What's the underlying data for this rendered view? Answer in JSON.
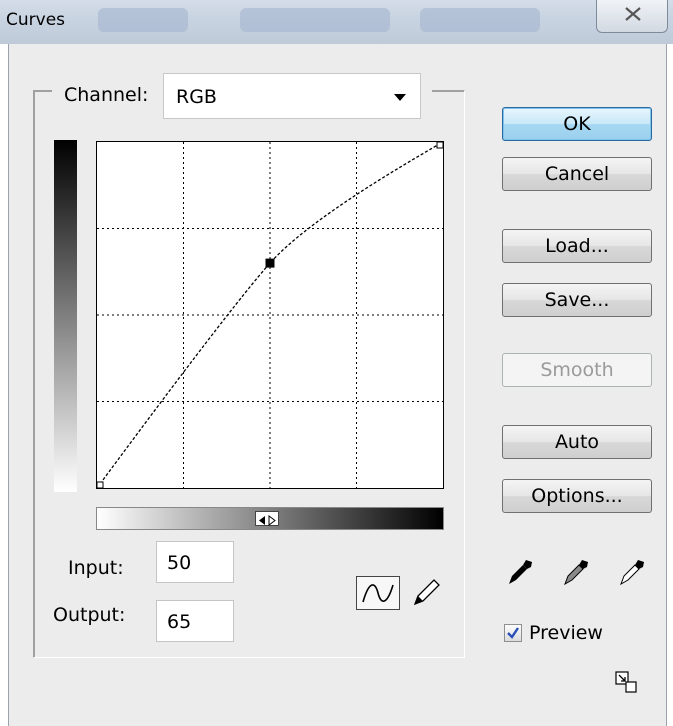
{
  "window": {
    "title": "Curves"
  },
  "channel": {
    "label": "Channel:",
    "value": "RGB"
  },
  "curve": {
    "input": 50,
    "output": 65,
    "points": [
      [
        0,
        0
      ],
      [
        50,
        65
      ],
      [
        100,
        100
      ]
    ]
  },
  "fields": {
    "input_label": "Input:",
    "input_value": "50",
    "output_label": "Output:",
    "output_value": "65"
  },
  "buttons": {
    "ok": "OK",
    "cancel": "Cancel",
    "load": "Load...",
    "save": "Save...",
    "smooth": "Smooth",
    "auto": "Auto",
    "options": "Options..."
  },
  "preview": {
    "label": "Preview",
    "checked": true
  },
  "icons": {
    "curve_tool": "curve-tool-icon",
    "pencil_tool": "pencil-icon",
    "black_eyedropper": "eyedropper-black-icon",
    "gray_eyedropper": "eyedropper-gray-icon",
    "white_eyedropper": "eyedropper-white-icon",
    "expand": "expand-icon",
    "close": "close-icon"
  },
  "colors": {
    "default_button": "#a7d8f2",
    "dialog_bg": "#ececec"
  }
}
